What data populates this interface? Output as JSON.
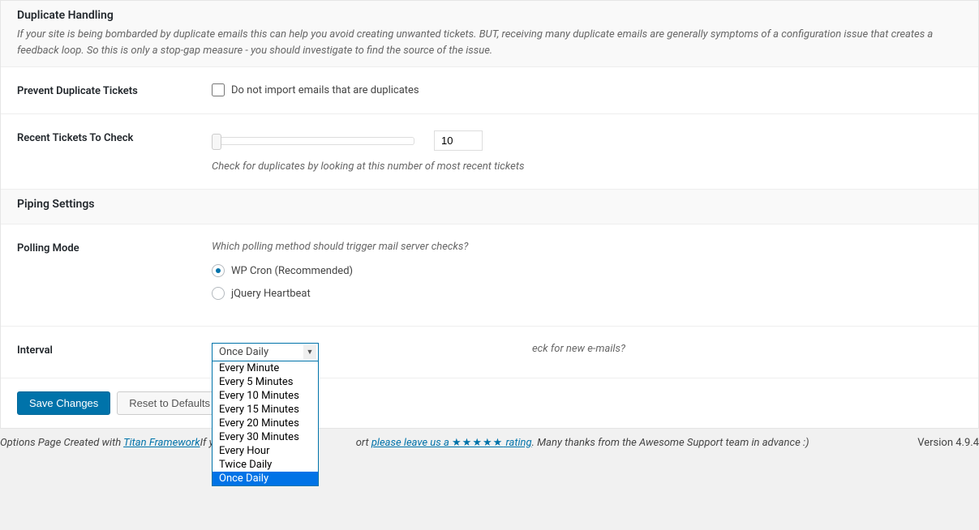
{
  "duplicate": {
    "title": "Duplicate Handling",
    "desc": "If your site is being bombarded by duplicate emails this can help you avoid creating unwanted tickets. BUT, receiving many duplicate emails are generally symptoms of a configuration issue that creates a feedback loop. So this is only a stop-gap measure - you should investigate to find the source of the issue."
  },
  "prevent": {
    "label": "Prevent Duplicate Tickets",
    "checkbox_label": "Do not import emails that are duplicates"
  },
  "recent": {
    "label": "Recent Tickets To Check",
    "value": "10",
    "help": "Check for duplicates by looking at this number of most recent tickets"
  },
  "piping": {
    "title": "Piping Settings"
  },
  "polling": {
    "label": "Polling Mode",
    "desc": "Which polling method should trigger mail server checks?",
    "options": [
      "WP Cron (Recommended)",
      "jQuery Heartbeat"
    ]
  },
  "interval": {
    "label": "Interval",
    "selected": "Once Daily",
    "help_tail": "eck for new e-mails?",
    "options": [
      "Every Minute",
      "Every 5 Minutes",
      "Every 10 Minutes",
      "Every 15 Minutes",
      "Every 20 Minutes",
      "Every 30 Minutes",
      "Every Hour",
      "Twice Daily",
      "Once Daily"
    ]
  },
  "actions": {
    "save": "Save Changes",
    "reset": "Reset to Defaults"
  },
  "footer": {
    "prefix": "Options Page Created with ",
    "titan": "Titan Framework",
    "mid1": "If y",
    "mid2": "ort ",
    "rating_link": "please leave us a ",
    "stars": "★★★★★",
    "rating_tail": " rating",
    "thanks": ". Many thanks from the Awesome Support team in advance :)",
    "version": "Version 4.9.4"
  }
}
